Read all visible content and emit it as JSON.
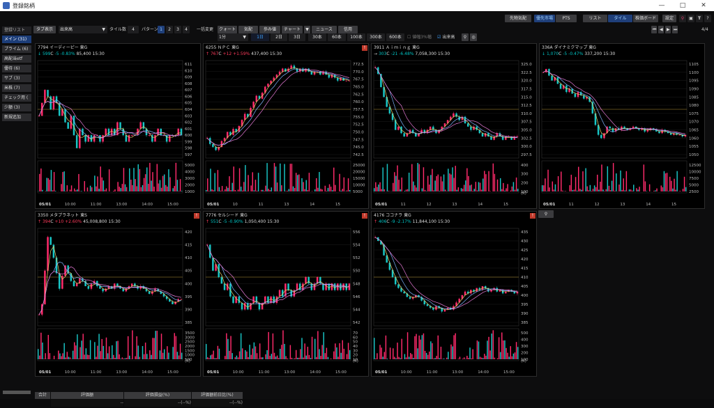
{
  "window": {
    "title": "登録銘柄"
  },
  "toprow": {
    "sentiment": "先物気配",
    "market": "優先市場",
    "pts": "PTS",
    "list": "リスト",
    "tile": "タイル",
    "board": "株価ボード",
    "settings": "設定",
    "page": "4/4"
  },
  "toolbar": {
    "tab_display": "タブ表示",
    "sort": "出来高",
    "tiles_label": "タイル数",
    "tiles_value": "4",
    "pattern_label": "パターン",
    "patterns": [
      "1",
      "2",
      "3",
      "4"
    ],
    "bulk_label": "一括変更",
    "tabs": [
      "クォート",
      "気配",
      "歩み値",
      "チャート",
      "ニュース",
      "信用"
    ],
    "interval": "1分",
    "periods": [
      "1日",
      "2日",
      "3日",
      "30本",
      "60本",
      "100本",
      "300本",
      "600本"
    ],
    "limit3": "値幅3%幅",
    "volume": "出来高"
  },
  "sidebar": {
    "items": [
      "登録リスト",
      "メイン (31)",
      "プライム (6)",
      "高配当etf",
      "優待 (6)",
      "サブ (3)",
      "米株 (7)",
      "チェック用 (",
      "少額 (3)",
      "新規追加"
    ]
  },
  "tiles": [
    {
      "code": "7794",
      "name": "イーディーピー",
      "mkt": "東G",
      "arrow": "↓",
      "price": "599",
      "cflag": "C",
      "change": "-5",
      "pct": "-0.83%",
      "volume": "85,400",
      "time": "15:30",
      "dir": "dn",
      "price_ticks": [
        "611",
        "610",
        "609",
        "608",
        "607",
        "606",
        "605",
        "604",
        "603",
        "602",
        "601",
        "600",
        "599",
        "598",
        "597"
      ],
      "vol_ticks": [
        "5000",
        "4000",
        "3000",
        "2000",
        "1000"
      ],
      "vol_unit": "",
      "x_labels": [
        "05/01",
        "10:00",
        "11:00",
        "13:00",
        "14:00",
        "15:00"
      ],
      "prices": [
        603,
        605,
        607,
        606,
        604,
        606,
        605,
        603,
        604,
        602,
        601,
        603,
        600,
        598,
        601,
        600,
        599,
        600,
        599,
        600,
        600,
        599,
        600,
        601,
        600,
        601,
        600,
        602,
        601,
        600,
        599,
        600,
        600,
        600,
        601,
        602,
        601,
        600,
        600,
        599,
        600,
        601,
        600,
        600,
        599,
        600,
        600,
        600,
        601,
        600
      ]
    },
    {
      "code": "6255",
      "name": "ＮＰＣ",
      "mkt": "東G",
      "arrow": "↑",
      "price": "767",
      "cflag": "C",
      "change": "+12",
      "pct": "+1.59%",
      "volume": "437,400",
      "time": "15:30",
      "dir": "up",
      "warn": true,
      "price_ticks": [
        "772.5",
        "770.0",
        "767.5",
        "765.0",
        "762.5",
        "760.0",
        "757.5",
        "755.0",
        "752.5",
        "750.0",
        "747.5",
        "745.0",
        "742.5"
      ],
      "vol_ticks": [
        "25000",
        "20000",
        "15000",
        "10000",
        "5000"
      ],
      "vol_unit": "",
      "x_labels": [
        "05/01",
        "10",
        "11",
        "13",
        "14",
        "15"
      ],
      "prices": [
        748,
        746,
        745,
        744,
        745,
        747,
        748,
        750,
        749,
        751,
        750,
        752,
        754,
        756,
        755,
        758,
        760,
        762,
        761,
        763,
        765,
        766,
        767,
        768,
        769,
        770,
        771,
        770,
        771,
        772,
        771,
        770,
        771,
        770,
        771,
        770,
        769,
        770,
        770,
        769,
        770,
        769,
        768,
        769,
        768,
        767,
        768,
        767,
        767,
        767
      ]
    },
    {
      "code": "3911",
      "name": "Ａｉｍｉｎｇ",
      "mkt": "東G",
      "arrow": "→",
      "price": "303",
      "cflag": "C",
      "change": "-21",
      "pct": "-6.48%",
      "volume": "7,058,300",
      "time": "15:30",
      "dir": "dn",
      "price_ticks": [
        "325.0",
        "322.5",
        "320.0",
        "317.5",
        "315.0",
        "312.5",
        "310.0",
        "307.5",
        "305.0",
        "302.5",
        "300.0",
        "297.5"
      ],
      "vol_ticks": [
        "400",
        "300",
        "200",
        "100"
      ],
      "vol_unit": "(K)",
      "x_labels": [
        "05/01",
        "11",
        "12",
        "13",
        "14",
        "15"
      ],
      "prices": [
        324,
        322,
        318,
        315,
        312,
        310,
        308,
        305,
        306,
        304,
        303,
        304,
        305,
        304,
        303,
        304,
        305,
        304,
        305,
        306,
        305,
        304,
        305,
        306,
        307,
        308,
        309,
        310,
        309,
        308,
        309,
        307,
        306,
        305,
        306,
        305,
        304,
        303,
        304,
        303,
        302,
        303,
        304,
        303,
        302,
        303,
        303,
        302,
        303,
        303
      ]
    },
    {
      "code": "336A",
      "name": "ダイナミクマップ",
      "mkt": "東G",
      "arrow": "↓",
      "price": "1,070",
      "cflag": "C",
      "change": "-5",
      "pct": "-0.47%",
      "volume": "337,200",
      "time": "15:30",
      "dir": "dn",
      "price_ticks": [
        "1105",
        "1100",
        "1095",
        "1090",
        "1085",
        "1080",
        "1075",
        "1070",
        "1065",
        "1060",
        "1055",
        "1050"
      ],
      "vol_ticks": [
        "12500",
        "10000",
        "7500",
        "5000",
        "2500"
      ],
      "vol_unit": "",
      "x_labels": [
        "05/01",
        "11",
        "12",
        "13",
        "14",
        "15"
      ],
      "prices": [
        1100,
        1102,
        1098,
        1095,
        1097,
        1093,
        1090,
        1092,
        1088,
        1090,
        1087,
        1085,
        1088,
        1086,
        1084,
        1085,
        1082,
        1075,
        1068,
        1062,
        1060,
        1063,
        1067,
        1066,
        1064,
        1066,
        1065,
        1067,
        1066,
        1065,
        1066,
        1067,
        1066,
        1065,
        1066,
        1064,
        1065,
        1066,
        1065,
        1064,
        1063,
        1065,
        1064,
        1063,
        1062,
        1063,
        1062,
        1062,
        1061,
        1062
      ]
    },
    {
      "code": "3350",
      "name": "メタプラネット",
      "mkt": "東S",
      "arrow": "↑",
      "price": "394",
      "cflag": "C",
      "change": "+10",
      "pct": "+2.60%",
      "volume": "45,008,800",
      "time": "15:30",
      "dir": "up",
      "warn": true,
      "price_ticks": [
        "420",
        "415",
        "410",
        "405",
        "400",
        "395",
        "390",
        "385"
      ],
      "vol_ticks": [
        "3500",
        "3000",
        "2500",
        "2000",
        "1500",
        "1000",
        "500"
      ],
      "vol_unit": "(K)",
      "x_labels": [
        "05/01",
        "10:00",
        "11:00",
        "13:00",
        "14:00",
        "15:00"
      ],
      "prices": [
        388,
        392,
        405,
        418,
        415,
        410,
        404,
        398,
        403,
        407,
        404,
        401,
        399,
        400,
        402,
        401,
        399,
        398,
        400,
        401,
        399,
        398,
        397,
        398,
        399,
        398,
        400,
        399,
        398,
        397,
        398,
        399,
        400,
        399,
        398,
        399,
        398,
        397,
        396,
        397,
        398,
        397,
        396,
        395,
        394,
        393,
        392,
        393,
        394,
        394
      ]
    },
    {
      "code": "7776",
      "name": "セルシード",
      "mkt": "東G",
      "arrow": "↑",
      "price": "551",
      "cflag": "C",
      "change": "-5",
      "pct": "-0.90%",
      "volume": "1,050,400",
      "time": "15:30",
      "dir": "dn",
      "warn": true,
      "price_ticks": [
        "556",
        "554",
        "552",
        "550",
        "548",
        "546",
        "544",
        "542"
      ],
      "vol_ticks": [
        "70",
        "60",
        "50",
        "40",
        "30",
        "20",
        "10"
      ],
      "vol_unit": "(K)",
      "x_labels": [
        "05/01",
        "10:00",
        "11:00",
        "13:00",
        "14:00",
        "15:00"
      ],
      "prices": [
        554,
        552,
        550,
        551,
        549,
        548,
        547,
        548,
        546,
        545,
        546,
        545,
        544,
        545,
        544,
        545,
        546,
        545,
        544,
        545,
        546,
        545,
        546,
        545,
        546,
        547,
        546,
        548,
        547,
        546,
        547,
        548,
        547,
        548,
        549,
        548,
        547,
        548,
        549,
        548,
        547,
        548,
        547,
        548,
        547,
        548,
        547,
        548,
        547,
        548
      ]
    },
    {
      "code": "4176",
      "name": "ココナラ",
      "mkt": "東G",
      "arrow": "↑",
      "price": "406",
      "cflag": "C",
      "change": "-9",
      "pct": "-2.17%",
      "volume": "11,844,100",
      "time": "15:30",
      "dir": "dn",
      "warn": true,
      "price_ticks": [
        "435",
        "430",
        "425",
        "420",
        "415",
        "410",
        "405",
        "400",
        "395",
        "390",
        "385"
      ],
      "vol_ticks": [
        "500",
        "400",
        "300",
        "200",
        "100"
      ],
      "vol_unit": "(K)",
      "x_labels": [
        "05/01",
        "10:00",
        "11:00",
        "13:00",
        "14:00",
        "15:00"
      ],
      "prices": [
        432,
        430,
        428,
        422,
        418,
        414,
        410,
        406,
        404,
        402,
        401,
        399,
        398,
        399,
        400,
        399,
        397,
        395,
        394,
        393,
        392,
        394,
        393,
        391,
        392,
        393,
        392,
        394,
        396,
        398,
        400,
        402,
        401,
        403,
        402,
        404,
        403,
        405,
        404,
        402,
        403,
        404,
        402,
        403,
        401,
        402,
        403,
        402,
        401,
        402
      ]
    }
  ],
  "summary": {
    "total_label": "合計",
    "headers": [
      "評価額",
      "評価損益(%)",
      "評価額前日比(%)"
    ],
    "values": [
      "--",
      "--(--%)",
      "--(--%)"
    ]
  },
  "colors": {
    "up": "#ff3b5c",
    "down": "#00c4c4",
    "candle_up": "#ff2b6b",
    "candle_down": "#19c6c6"
  }
}
